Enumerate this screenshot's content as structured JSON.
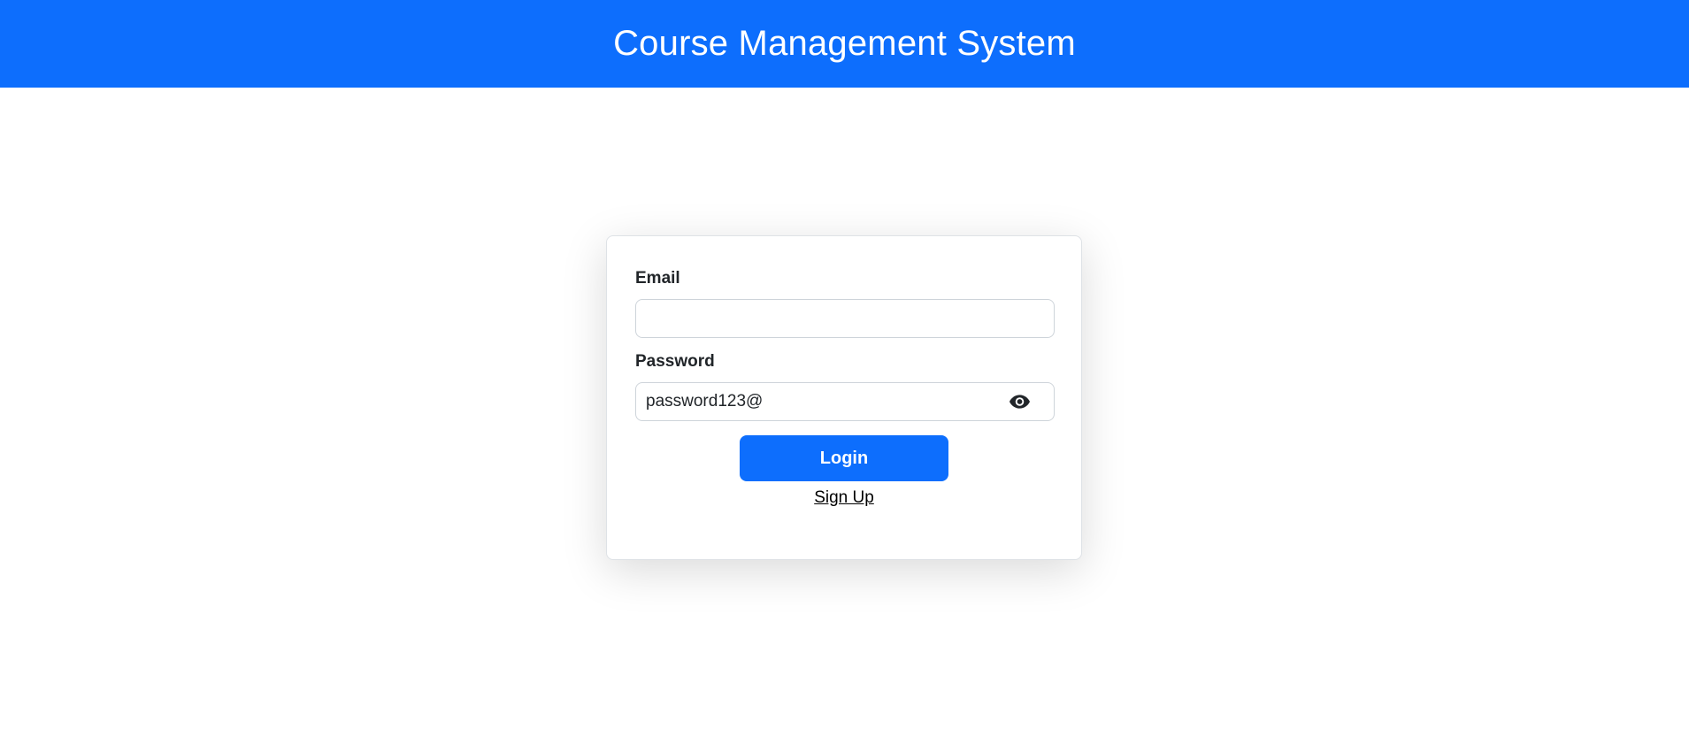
{
  "header": {
    "title": "Course Management System"
  },
  "login_form": {
    "email_label": "Email",
    "email_value": "",
    "password_label": "Password",
    "password_value": "password123@",
    "show_password_icon": "eye-icon",
    "login_label": "Login",
    "signup_label": "Sign Up"
  },
  "colors": {
    "primary": "#0d6efd",
    "header_text": "#ffffff"
  }
}
